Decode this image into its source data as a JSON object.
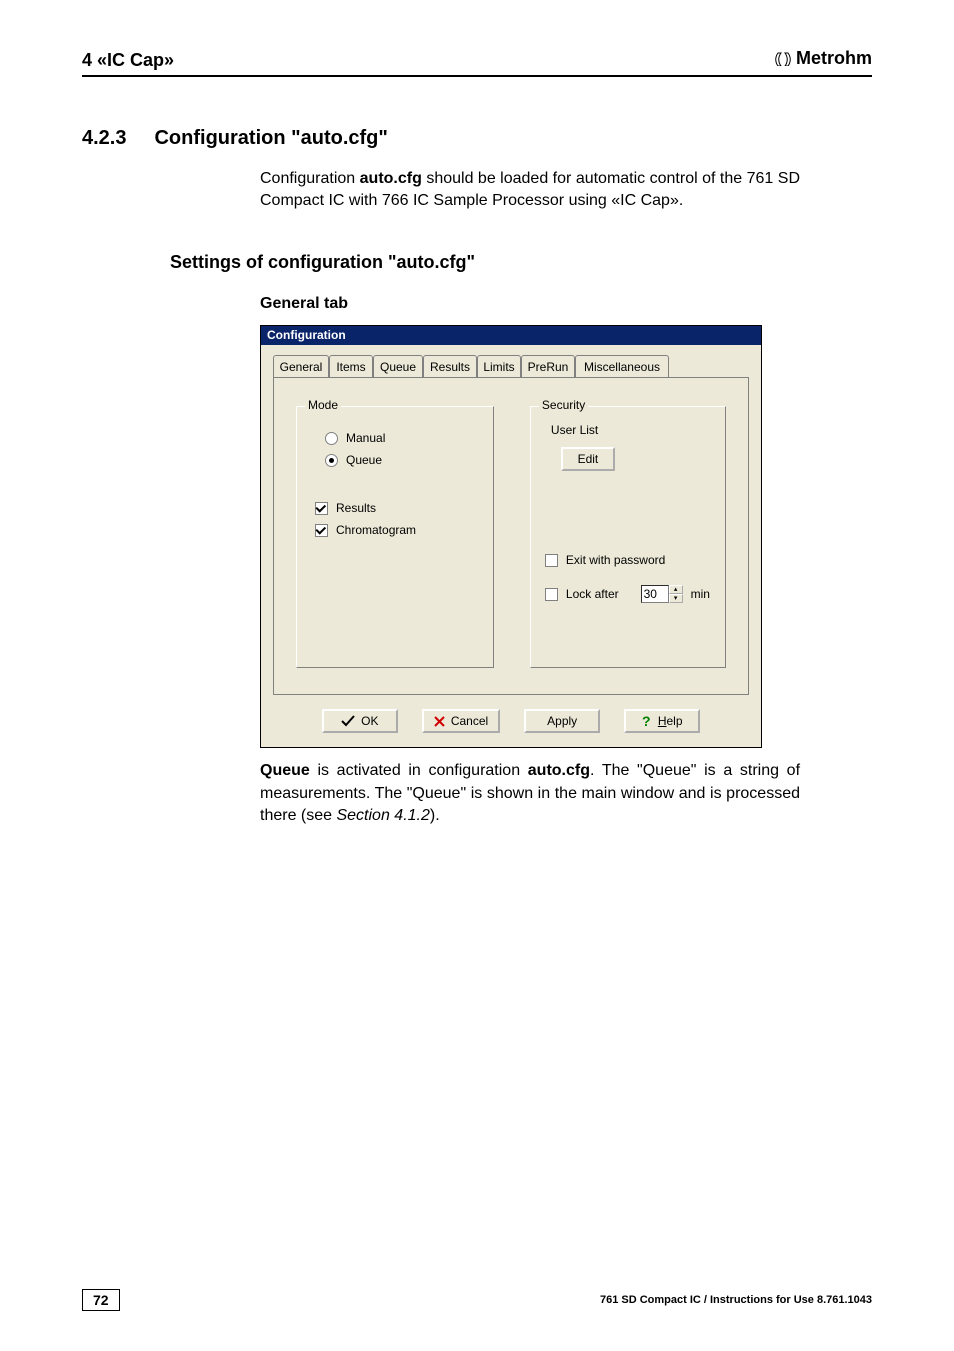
{
  "header": {
    "left": "4 «IC Cap»",
    "brand": "Metrohm"
  },
  "section": {
    "number": "4.2.3",
    "title": "Configuration \"auto.cfg\""
  },
  "intro": {
    "prefix": "Configuration ",
    "bold1": "auto.cfg",
    "rest": " should be loaded for automatic control of the 761 SD Compact IC with 766 IC Sample Processor using «IC Cap»."
  },
  "subhead": "Settings of configuration \"auto.cfg\"",
  "subsubhead": "General tab",
  "dialog": {
    "title": "Configuration",
    "tabs": [
      "General",
      "Items",
      "Queue",
      "Results",
      "Limits",
      "PreRun",
      "Miscellaneous"
    ],
    "mode": {
      "legend": "Mode",
      "manual": "Manual",
      "queue": "Queue",
      "results": "Results",
      "chromatogram": "Chromatogram"
    },
    "security": {
      "legend": "Security",
      "userlist": "User List",
      "edit": "Edit",
      "exitpw": "Exit with password",
      "lockafter": "Lock after",
      "lockvalue": "30",
      "min": "min"
    },
    "buttons": {
      "ok": "OK",
      "cancel": "Cancel",
      "apply": "Apply",
      "help": "Help",
      "help_u": "H"
    }
  },
  "after": {
    "bold1": "Queue",
    "text1": " is activated in configuration ",
    "bold2": "auto.cfg",
    "text2": ". The \"Queue\" is a string of measurements. The \"Queue\" is shown in the main window and is processed there (see ",
    "italic": "Section 4.1.2",
    "text3": ")."
  },
  "footer": {
    "page": "72",
    "right": "761 SD Compact IC / Instructions for Use  8.761.1043"
  }
}
